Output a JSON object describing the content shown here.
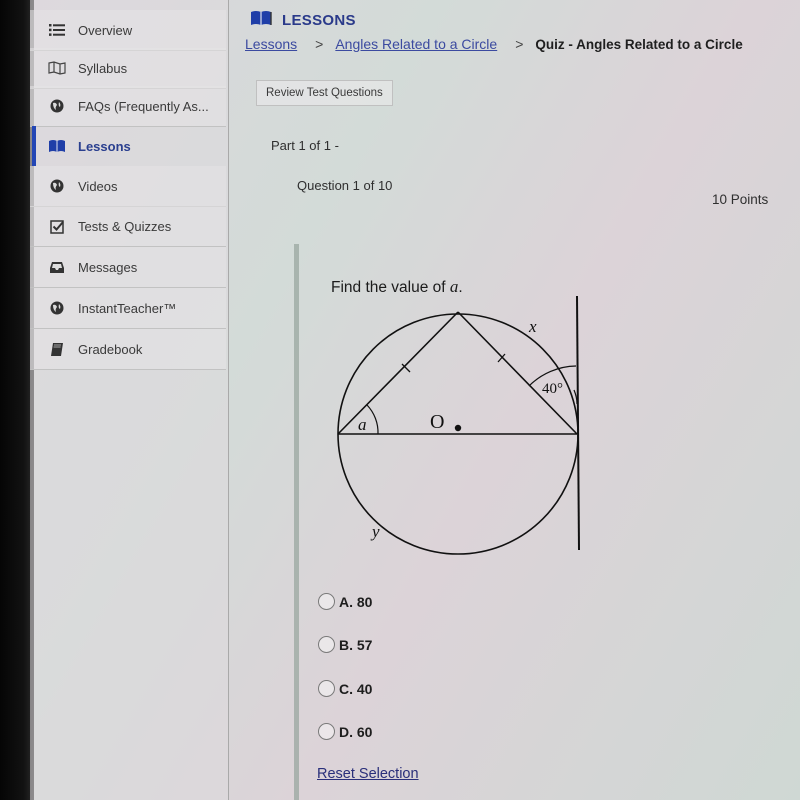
{
  "sidebar": {
    "items": [
      {
        "label": "Overview",
        "icon": "list-icon",
        "active": false
      },
      {
        "label": "Syllabus",
        "icon": "map-icon",
        "active": false
      },
      {
        "label": "FAQs (Frequently As...",
        "icon": "globe-icon",
        "active": false
      },
      {
        "label": "Lessons",
        "icon": "book-open-icon",
        "active": true
      },
      {
        "label": "Videos",
        "icon": "globe-icon",
        "active": false
      },
      {
        "label": "Tests & Quizzes",
        "icon": "checkbox-icon",
        "active": false
      },
      {
        "label": "Messages",
        "icon": "inbox-icon",
        "active": false
      },
      {
        "label": "InstantTeacher™",
        "icon": "globe-icon",
        "active": false
      },
      {
        "label": "Gradebook",
        "icon": "book-icon",
        "active": false
      }
    ]
  },
  "header": {
    "section_title": "LESSONS",
    "breadcrumb": [
      {
        "label": "Lessons",
        "link": true
      },
      {
        "label": "Angles Related to a Circle",
        "link": true
      },
      {
        "label": "Quiz - Angles Related to a Circle",
        "link": false
      }
    ],
    "separator": ">"
  },
  "toolbar": {
    "review_label": "Review Test Questions"
  },
  "quiz": {
    "part": "Part 1 of 1 -",
    "question_number": "Question 1 of 10",
    "points": "10 Points",
    "prompt_prefix": "Find the value of ",
    "prompt_var": "a",
    "prompt_suffix": ".",
    "diagram": {
      "labels": {
        "x": "x",
        "y": "y",
        "a": "a",
        "center": "O",
        "angle": "40°"
      }
    },
    "choices": [
      {
        "label": "A. 80",
        "selected": false
      },
      {
        "label": "B. 57",
        "selected": false
      },
      {
        "label": "C. 40",
        "selected": false
      },
      {
        "label": "D. 60",
        "selected": false
      }
    ],
    "reset_label": "Reset Selection"
  },
  "colors": {
    "accent": "#2346b5",
    "link": "#3b4aa0"
  }
}
